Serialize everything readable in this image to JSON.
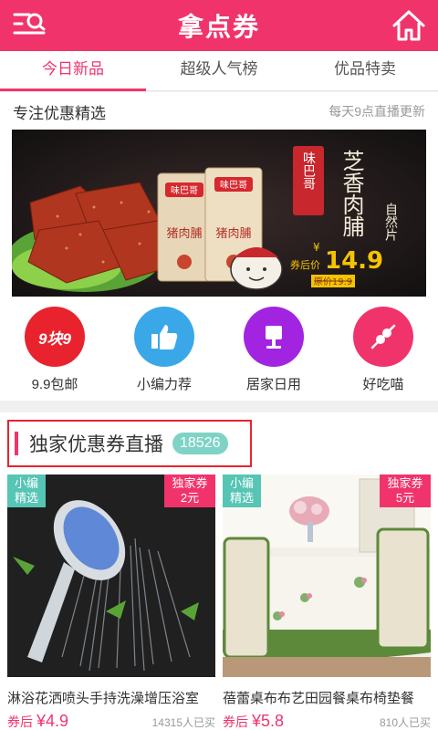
{
  "header": {
    "title": "拿点券"
  },
  "tabs": [
    {
      "label": "今日新品"
    },
    {
      "label": "超级人气榜"
    },
    {
      "label": "优品特卖"
    }
  ],
  "featured": {
    "title": "专注优惠精选",
    "note": "每天9点直播更新",
    "banner": {
      "brand_seal": "味巴哥",
      "product_title": "芝香肉脯",
      "subtitle": "自然片",
      "price_label": "券后价",
      "price_currency": "¥",
      "price": "14.9",
      "original_price": "原价19.9",
      "package_brand": "味巴哥",
      "package_name": "猪肉脯"
    }
  },
  "categories": [
    {
      "label": "9.9包邮",
      "badge": "9块9",
      "icon": "nine-nine-badge-icon",
      "color": "#e8232e"
    },
    {
      "label": "小编力荐",
      "icon": "thumbs-up-icon",
      "color": "#3aa8e8"
    },
    {
      "label": "居家日用",
      "icon": "lamp-icon",
      "color": "#a224e0"
    },
    {
      "label": "好吃喵",
      "icon": "skewer-icon",
      "color": "#f0346b"
    }
  ],
  "live": {
    "title": "独家优惠券直播",
    "count": "18526"
  },
  "products": [
    {
      "tag_left": "小编精选",
      "tag_right_title": "独家券",
      "tag_right_value": "2元",
      "name": "淋浴花洒喷头手持洗澡增压浴室",
      "price_label": "券后",
      "price": "¥4.9",
      "sold": "14315人已买"
    },
    {
      "tag_left": "小编精选",
      "tag_right_title": "独家券",
      "tag_right_value": "5元",
      "name": "蓓蕾桌布布艺田园餐桌布椅垫餐",
      "price_label": "券后",
      "price": "¥5.8",
      "sold": "810人已买"
    }
  ]
}
